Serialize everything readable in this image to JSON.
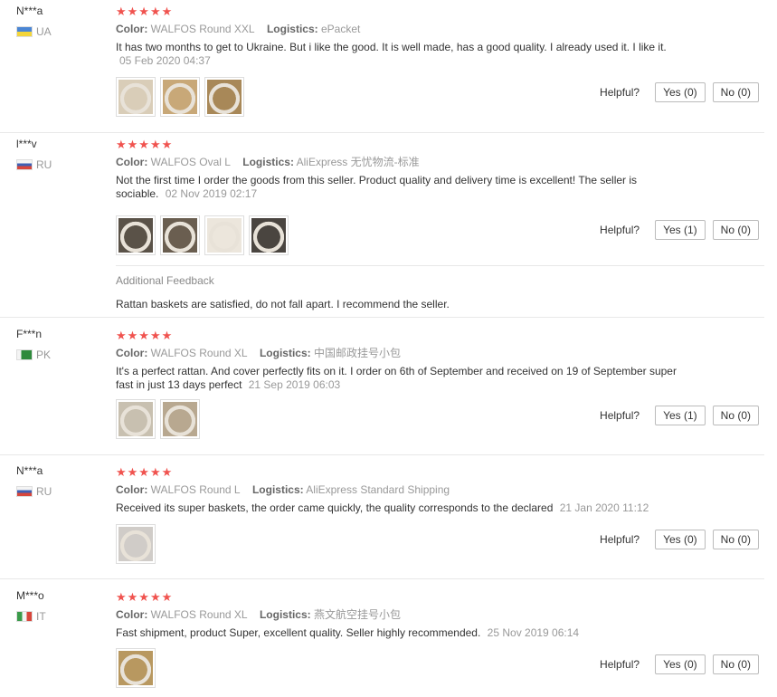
{
  "reviews": [
    {
      "user": "N***a",
      "country": "UA",
      "flag": "ua-flag-icon",
      "stars": "★★★★★",
      "color_label": "Color:",
      "color": "WALFOS Round XXL",
      "logistics_label": "Logistics:",
      "logistics": "ePacket",
      "text": "It has two months to get to Ukraine. But i like the good. It is well made, has a good quality. I already used it. I like it.",
      "date": "05 Feb 2020 04:37",
      "helpful_label": "Helpful?",
      "yes": "Yes (0)",
      "no": "No (0)",
      "thumb_colors": [
        "#d9cdb8",
        "#c8a878",
        "#a88858"
      ]
    },
    {
      "user": "l***v",
      "country": "RU",
      "flag": "ru-flag-icon",
      "stars": "★★★★★",
      "color_label": "Color:",
      "color": "WALFOS Oval L",
      "logistics_label": "Logistics:",
      "logistics": "AliExpress 无忧物流-标准",
      "text": "Not the first time I order the goods from this seller. Product quality and delivery time is excellent! The seller is sociable.",
      "date": "02 Nov 2019 02:17",
      "helpful_label": "Helpful?",
      "yes": "Yes (1)",
      "no": "No (0)",
      "thumb_colors": [
        "#5a5248",
        "#6a5e50",
        "#ece6dc",
        "#4a4540"
      ],
      "additional_title": "Additional Feedback",
      "additional_text": "Rattan baskets are satisfied, do not fall apart. I recommend the seller."
    },
    {
      "user": "F***n",
      "country": "PK",
      "flag": "pk-flag-icon",
      "stars": "★★★★★",
      "color_label": "Color:",
      "color": "WALFOS Round XL",
      "logistics_label": "Logistics:",
      "logistics": "中国邮政挂号小包",
      "text": "It's a perfect rattan. And cover perfectly fits on it. I order on 6th of September and received on 19 of September super fast in just 13 days perfect",
      "date": "21 Sep 2019 06:03",
      "helpful_label": "Helpful?",
      "yes": "Yes (1)",
      "no": "No (0)",
      "thumb_colors": [
        "#c8c0b0",
        "#b8a890"
      ]
    },
    {
      "user": "N***a",
      "country": "RU",
      "flag": "ru-flag-icon",
      "stars": "★★★★★",
      "color_label": "Color:",
      "color": "WALFOS Round L",
      "logistics_label": "Logistics:",
      "logistics": "AliExpress Standard Shipping",
      "text": "Received its super baskets, the order came quickly, the quality corresponds to the declared",
      "date": "21 Jan 2020 11:12",
      "helpful_label": "Helpful?",
      "yes": "Yes (0)",
      "no": "No (0)",
      "thumb_colors": [
        "#d0ccc8"
      ]
    },
    {
      "user": "M***o",
      "country": "IT",
      "flag": "it-flag-icon",
      "stars": "★★★★★",
      "color_label": "Color:",
      "color": "WALFOS Round XL",
      "logistics_label": "Logistics:",
      "logistics": "燕文航空挂号小包",
      "text": "Fast shipment, product Super, excellent quality. Seller highly recommended.",
      "date": "25 Nov 2019 06:14",
      "helpful_label": "Helpful?",
      "yes": "Yes (0)",
      "no": "No (0)",
      "thumb_colors": [
        "#b89860"
      ]
    }
  ]
}
